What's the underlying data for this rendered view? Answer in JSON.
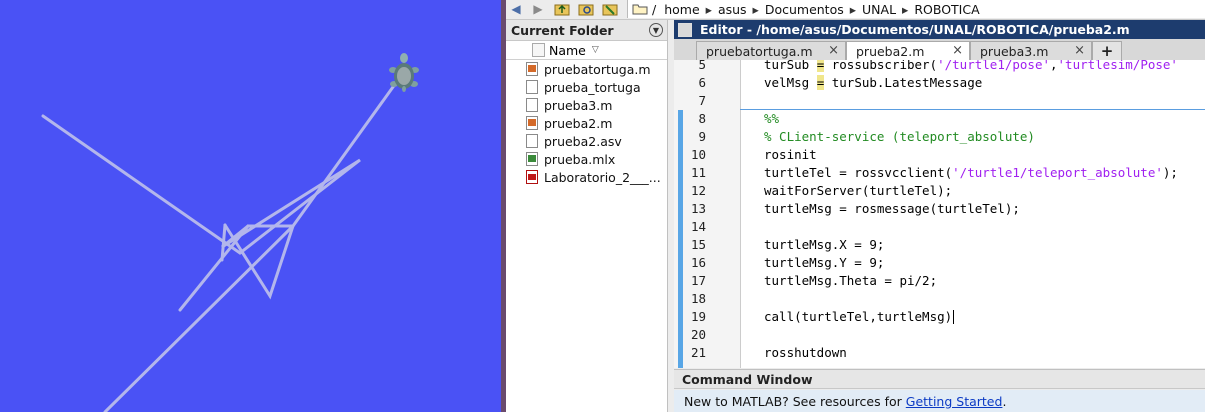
{
  "turtlesim": {
    "background": "#4a52f5",
    "pen_color": "#b3b6ec"
  },
  "toolbar": {
    "icons": [
      "back-arrow-icon",
      "forward-arrow-icon",
      "up-folder-icon",
      "browse-folder-icon",
      "new-folder-icon"
    ],
    "path": [
      "/",
      "home",
      "asus",
      "Documentos",
      "UNAL",
      "ROBOTICA"
    ]
  },
  "current_folder": {
    "title": "Current Folder",
    "column_header": "Name",
    "files": [
      {
        "name": "pruebatortuga.m",
        "icon": "m-file-icon"
      },
      {
        "name": "prueba_tortuga",
        "icon": "file-icon"
      },
      {
        "name": "prueba3.m",
        "icon": "file-icon"
      },
      {
        "name": "prueba2.m",
        "icon": "m-file-icon"
      },
      {
        "name": "prueba2.asv",
        "icon": "file-icon"
      },
      {
        "name": "prueba.mlx",
        "icon": "mlx-file-icon"
      },
      {
        "name": "Laboratorio_2___...",
        "icon": "pdf-file-icon"
      }
    ]
  },
  "editor": {
    "title": "Editor - /home/asus/Documentos/UNAL/ROBOTICA/prueba2.m",
    "tabs": [
      {
        "label": "pruebatortuga.m",
        "active": false
      },
      {
        "label": "prueba2.m",
        "active": true
      },
      {
        "label": "prueba3.m",
        "active": false
      }
    ],
    "add_tab": "+",
    "lines": [
      {
        "n": "5",
        "code": "turSub = rossubscriber('/turtle1/pose','turtlesim/Pose'"
      },
      {
        "n": "6",
        "code": "velMsg = turSub.LatestMessage"
      },
      {
        "n": "7",
        "code": ""
      },
      {
        "n": "8",
        "code": "%%"
      },
      {
        "n": "9",
        "code": "% CLient-service (teleport_absolute)"
      },
      {
        "n": "10",
        "code": "rosinit"
      },
      {
        "n": "11",
        "code": "turtleTel = rossvcclient('/turtle1/teleport_absolute');"
      },
      {
        "n": "12",
        "code": "waitForServer(turtleTel);"
      },
      {
        "n": "13",
        "code": "turtleMsg = rosmessage(turtleTel);"
      },
      {
        "n": "14",
        "code": ""
      },
      {
        "n": "15",
        "code": "turtleMsg.X = 9;"
      },
      {
        "n": "16",
        "code": "turtleMsg.Y = 9;"
      },
      {
        "n": "17",
        "code": "turtleMsg.Theta = pi/2;"
      },
      {
        "n": "18",
        "code": ""
      },
      {
        "n": "19",
        "code": "call(turtleTel,turtleMsg)"
      },
      {
        "n": "20",
        "code": ""
      },
      {
        "n": "21",
        "code": "rosshutdown"
      }
    ]
  },
  "command_window": {
    "title": "Command Window",
    "message": "New to MATLAB? See resources for",
    "link": "Getting Started",
    "suffix": "."
  }
}
